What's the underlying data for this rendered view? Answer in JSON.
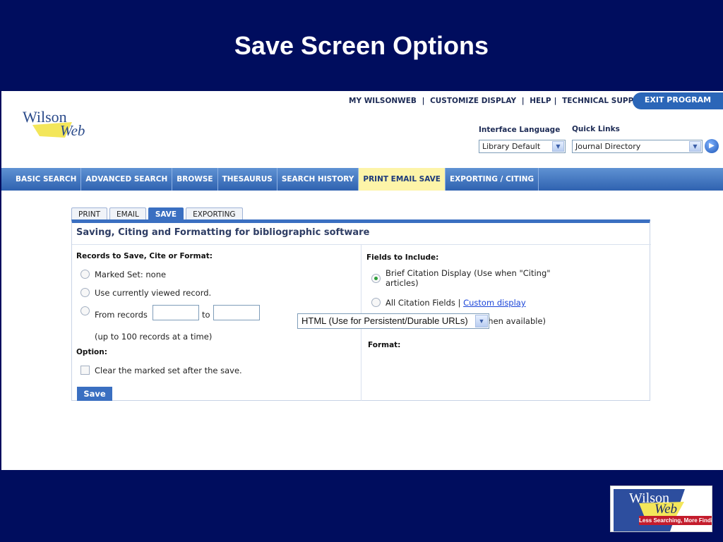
{
  "slide": {
    "title": "Save Screen Options"
  },
  "header": {
    "logo": {
      "line1": "Wilson",
      "line2": "Web"
    },
    "top_links": [
      "MY WILSONWEB",
      "CUSTOMIZE DISPLAY",
      "HELP",
      "TECHNICAL SUPPORT"
    ],
    "separator": "|",
    "exit_label": "EXIT PROGRAM",
    "interface_language": {
      "label": "Interface Language",
      "value": "Library Default"
    },
    "quick_links": {
      "label": "Quick Links",
      "value": "Journal Directory"
    }
  },
  "nav": {
    "tabs": [
      {
        "label": "BASIC SEARCH",
        "active": false
      },
      {
        "label": "ADVANCED SEARCH",
        "active": false
      },
      {
        "label": "BROWSE",
        "active": false
      },
      {
        "label": "THESAURUS",
        "active": false
      },
      {
        "label": "SEARCH HISTORY",
        "active": false
      },
      {
        "label": "PRINT EMAIL SAVE",
        "active": true
      },
      {
        "label": "EXPORTING / CITING",
        "active": false
      }
    ]
  },
  "subtabs": [
    {
      "label": "PRINT",
      "active": false
    },
    {
      "label": "EMAIL",
      "active": false
    },
    {
      "label": "SAVE",
      "active": true
    },
    {
      "label": "EXPORTING",
      "active": false
    }
  ],
  "panel": {
    "title": "Saving, Citing and Formatting for bibliographic software",
    "records_heading": "Records to Save, Cite or Format:",
    "marked_set": "Marked Set: none",
    "current_record": "Use currently viewed record.",
    "from_records": "From records",
    "to": "to",
    "from_value": "",
    "to_value": "",
    "limit_note": "(up to 100 records at a time)",
    "option_heading": "Option:",
    "clear_marked": "Clear the marked set after the save.",
    "save_label": "Save",
    "fields_heading": "Fields to Include:",
    "brief_citation_line1": "Brief Citation Display (Use when \"Citing\"",
    "brief_citation_line2": "articles)",
    "all_citation": "All Citation Fields",
    "custom_display": "Custom display",
    "include_html": "Include HTML Full Text (when available)",
    "format_heading": "Format:",
    "format_value": "HTML (Use for Persistent/Durable URLs)"
  },
  "bottom_logo": {
    "line1": "Wilson",
    "line2": "Web",
    "tagline": "Less Searching, More Finding"
  },
  "colors": {
    "slide_bg": "#000d5e",
    "nav_blue": "#2f62b0",
    "active_tab": "#fdf4a8",
    "accent": "#3a6fc1"
  }
}
